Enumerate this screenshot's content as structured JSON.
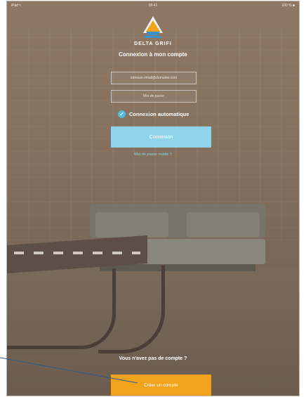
{
  "status_bar": {
    "left": "iPad ≈",
    "time": "09:41",
    "right": "100 % ■"
  },
  "brand": {
    "name": "DELTA GRIFI"
  },
  "login": {
    "title": "Connexion à mon compte",
    "email_value": "adresse.email@domaine.com",
    "password_placeholder": "Mot de passe",
    "auto_connect_label": "Connexion automatique",
    "auto_connect_checked": true,
    "connect_label": "Connexion",
    "forgot_label": "Mot de passe oublié ?"
  },
  "signup": {
    "prompt": "Vous n'avez pas de compte ?",
    "create_label": "Créer un compte"
  },
  "colors": {
    "accent_blue": "#90d4ea",
    "check_blue": "#55b7e0",
    "create_orange": "#f2a31c",
    "overlay_brown": "#86715f"
  }
}
